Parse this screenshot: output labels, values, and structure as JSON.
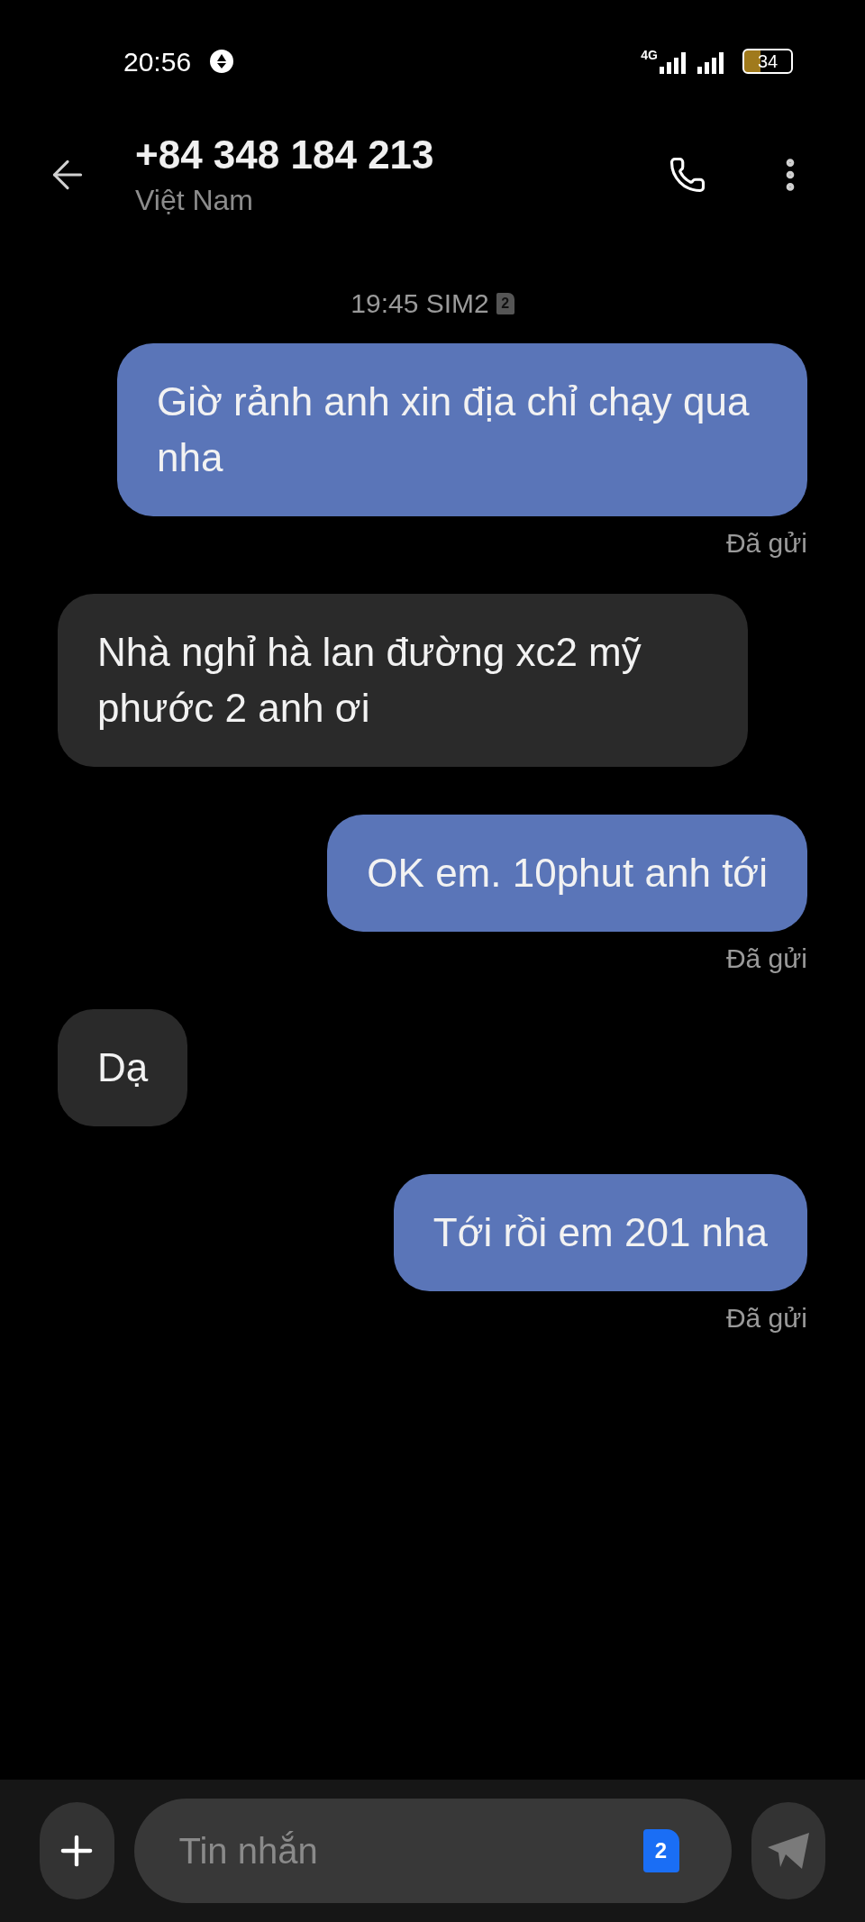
{
  "status_bar": {
    "time": "20:56",
    "network": "4G",
    "battery": "34"
  },
  "header": {
    "title": "+84 348 184 213",
    "subtitle": "Việt Nam"
  },
  "timestamp": {
    "text": "19:45 SIM2",
    "sim": "2"
  },
  "messages": [
    {
      "kind": "outgoing",
      "text": "Giờ rảnh anh xin địa chỉ chạy qua nha",
      "status": "Đã gửi"
    },
    {
      "kind": "incoming",
      "text": "Nhà nghỉ hà lan đường xc2 mỹ phước 2 anh ơi"
    },
    {
      "kind": "outgoing",
      "text": "OK em. 10phut anh tới",
      "status": "Đã gửi"
    },
    {
      "kind": "incoming",
      "text": "Dạ"
    },
    {
      "kind": "outgoing",
      "text": "Tới rồi em 201 nha",
      "status": "Đã gửi"
    }
  ],
  "composer": {
    "placeholder": "Tin nhắn",
    "sim": "2"
  }
}
